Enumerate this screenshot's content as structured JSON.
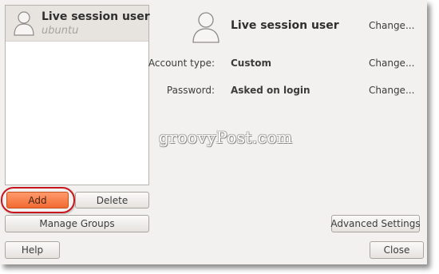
{
  "sidebar": {
    "users": [
      {
        "name": "Live session user",
        "subtitle": "ubuntu",
        "selected": true
      }
    ],
    "add_label": "Add",
    "delete_label": "Delete",
    "manage_groups_label": "Manage Groups"
  },
  "details": {
    "name": "Live session user",
    "name_change_label": "Change...",
    "account_type_label": "Account type:",
    "account_type_value": "Custom",
    "account_type_change_label": "Change...",
    "password_label": "Password:",
    "password_value": "Asked on login",
    "password_change_label": "Change...",
    "advanced_settings_label": "Advanced Settings"
  },
  "footer": {
    "help_label": "Help",
    "close_label": "Close"
  },
  "watermark": "groovyPost.com",
  "colors": {
    "window_bg": "#f2f1f0",
    "selected_row_bg": "#e7e4df",
    "add_button_accent": "#f26a33",
    "highlight_ring": "#c8161d"
  }
}
